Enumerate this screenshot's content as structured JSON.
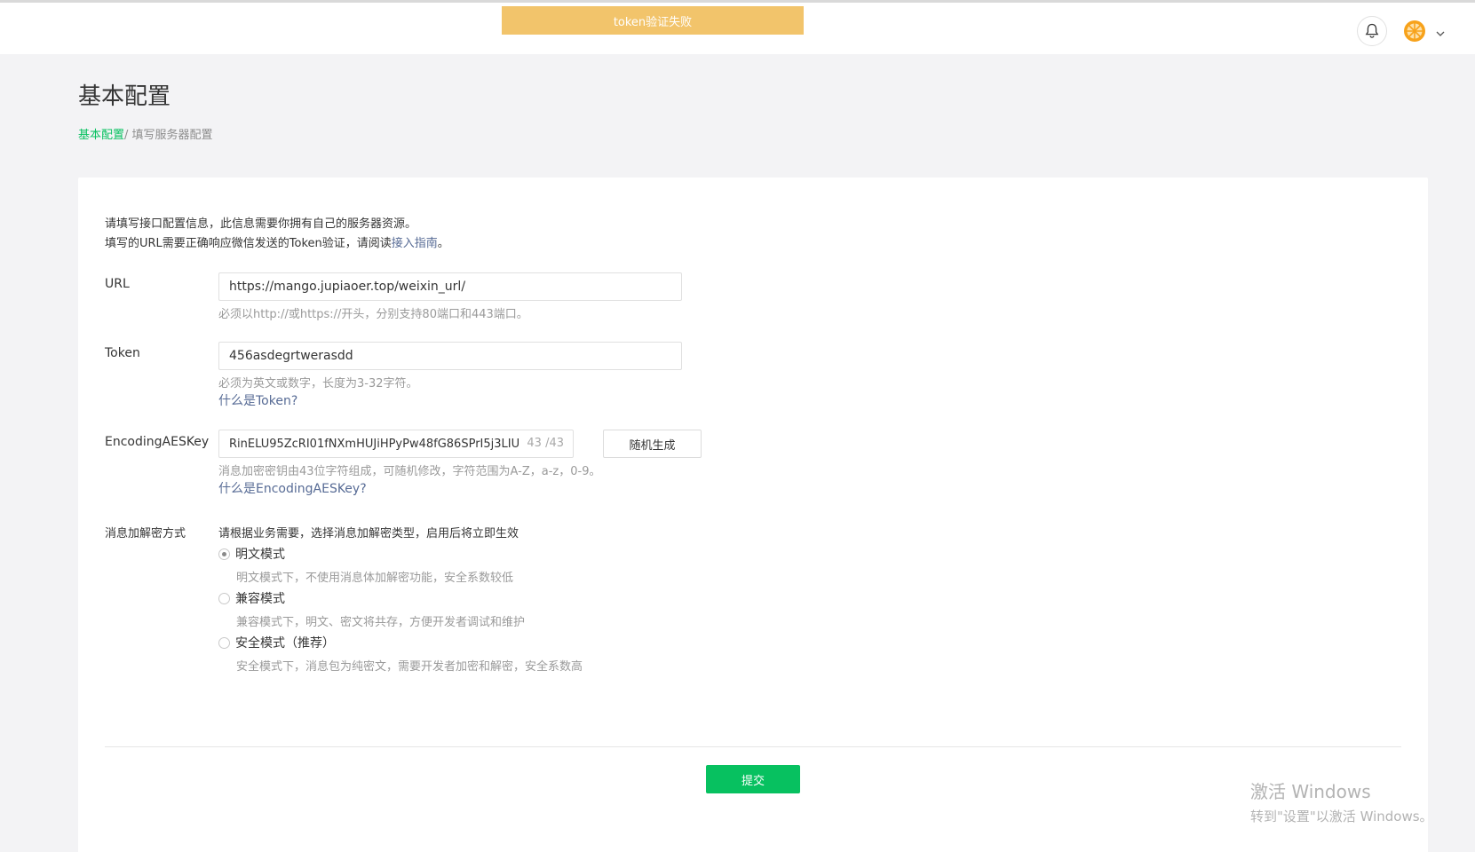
{
  "toast": {
    "text": "token验证失败",
    "color": "#f2c46b"
  },
  "header": {
    "bell_icon": "bell-icon",
    "avatar_icon": "orange-avatar-icon",
    "menu_icon": "chevron-down-icon"
  },
  "page": {
    "title": "基本配置",
    "breadcrumb": {
      "root": "基本配置",
      "current": "/ 填写服务器配置"
    }
  },
  "intro": {
    "line1": "请填写接口配置信息，此信息需要你拥有自己的服务器资源。",
    "line2_prefix": "填写的URL需要正确响应微信发送的Token验证，请阅读",
    "line2_link": "接入指南",
    "line2_suffix": "。"
  },
  "form": {
    "url": {
      "label": "URL",
      "value": "https://mango.jupiaoer.top/weixin_url/",
      "hint": "必须以http://或https://开头，分别支持80端口和443端口。"
    },
    "token": {
      "label": "Token",
      "value": "456asdegrtwerasdd",
      "hint": "必须为英文或数字，长度为3-32字符。",
      "help_link": "什么是Token?"
    },
    "aeskey": {
      "label": "EncodingAESKey",
      "value": "RinELU95ZcRI01fNXmHUJiHPyPw48fG86SPrI5j3LIU",
      "counter": "43 /43",
      "random_button": "随机生成",
      "hint": "消息加密密钥由43位字符组成，可随机修改，字符范围为A-Z，a-z，0-9。",
      "help_link": "什么是EncodingAESKey?"
    },
    "mode": {
      "label": "消息加解密方式",
      "desc": "请根据业务需要，选择消息加解密类型，启用后将立即生效",
      "options": [
        {
          "label": "明文模式",
          "sub": "明文模式下，不使用消息体加解密功能，安全系数较低",
          "checked": true
        },
        {
          "label": "兼容模式",
          "sub": "兼容模式下，明文、密文将共存，方便开发者调试和维护",
          "checked": false
        },
        {
          "label": "安全模式（推荐）",
          "sub": "安全模式下，消息包为纯密文，需要开发者加密和解密，安全系数高",
          "checked": false
        }
      ]
    },
    "submit": "提交"
  },
  "watermark": {
    "line1": "激活 Windows",
    "line2": "转到\"设置\"以激活 Windows。"
  },
  "colors": {
    "brand_green": "#07c160",
    "link_blue": "#576b95"
  }
}
